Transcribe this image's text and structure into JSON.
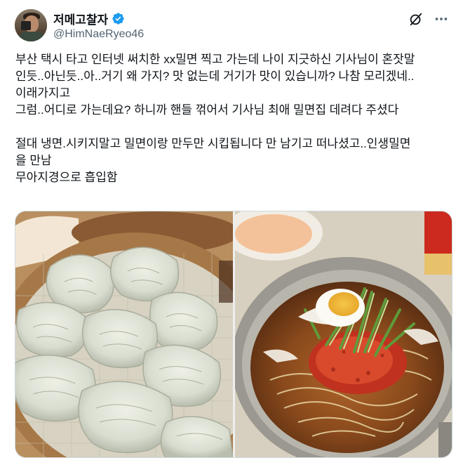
{
  "author": {
    "display_name": "저메고찰자",
    "handle": "@HimNaeRyeo46",
    "verified_icon": "verified-badge-icon",
    "verified_color": "#1d9bf0"
  },
  "header_icons": [
    "grok-icon",
    "more-icon"
  ],
  "tweet": {
    "lines": [
      "부산 택시 타고 인터넷 써치한 xx밀면 찍고 가는데 나이 지긋하신 기사님이 혼잣말",
      "인듯..아닌듯..아..거기 왜 가지? 맛 없는데 거기가 맛이 있습니까? 나참 모리겠네..",
      "이래가지고",
      "그럼..어디로 가는데요? 하니까 핸들 꺾어서 기사님 최애 밀면집 데려다 주셨다",
      "절대 냉면.시키지말고 밀면이랑 만두만 시킵됩니다 만 남기고 떠나셨고..인생밀면",
      "을 만남",
      "무아지경으로 흡입함"
    ]
  },
  "media": {
    "photos": [
      {
        "subject": "steamed mandu dumplings in bamboo steamer"
      },
      {
        "subject": "bowl of milmyeon with egg, cucumber and red sauce"
      }
    ]
  },
  "colors": {
    "text_primary": "#0f1419",
    "text_secondary": "#536471",
    "border": "#cfd9de"
  }
}
